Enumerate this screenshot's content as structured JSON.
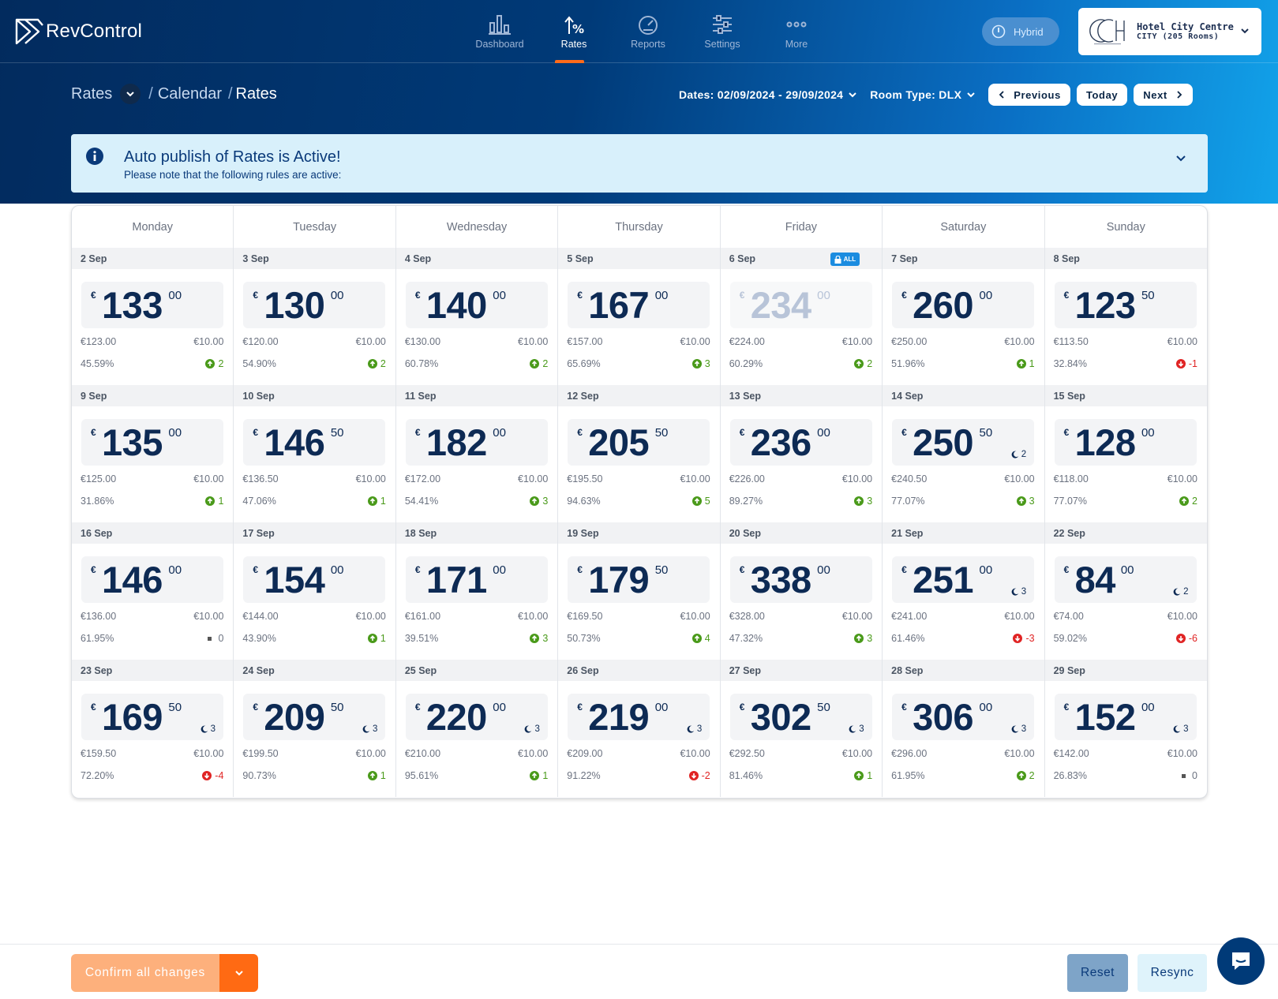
{
  "app": {
    "name": "RevControl"
  },
  "nav": [
    {
      "label": "Dashboard",
      "icon": "bar-chart-icon",
      "active": false
    },
    {
      "label": "Rates",
      "icon": "percent-arrow-icon",
      "active": true
    },
    {
      "label": "Reports",
      "icon": "gauge-icon",
      "active": false
    },
    {
      "label": "Settings",
      "icon": "sliders-icon",
      "active": false
    },
    {
      "label": "More",
      "icon": "more-dots-icon",
      "active": false
    }
  ],
  "mode_badge": "Hybrid",
  "hotel": {
    "name": "Hotel City Centre",
    "subtitle": "CITY (205 Rooms)"
  },
  "breadcrumb": {
    "root": "Rates",
    "middle": "Calendar",
    "current": "Rates",
    "separator": "/"
  },
  "filters": {
    "dates": "Dates: 02/09/2024 - 29/09/2024",
    "room_type": "Room Type: DLX"
  },
  "pager": {
    "previous": "Previous",
    "today": "Today",
    "next": "Next"
  },
  "alert": {
    "title": "Auto publish of Rates is Active!",
    "message": "Please note that the following rules are active:"
  },
  "weekdays": [
    "Monday",
    "Tuesday",
    "Wednesday",
    "Thursday",
    "Friday",
    "Saturday",
    "Sunday"
  ],
  "currency_symbol": "€",
  "lock_label": "ALL",
  "days": [
    {
      "date": "2 Sep",
      "int": "133",
      "dec": "00",
      "base": "€123.00",
      "delta": "€10.00",
      "occupancy": "45.59%",
      "trend": "up",
      "pickup": "2"
    },
    {
      "date": "3 Sep",
      "int": "130",
      "dec": "00",
      "base": "€120.00",
      "delta": "€10.00",
      "occupancy": "54.90%",
      "trend": "up",
      "pickup": "2"
    },
    {
      "date": "4 Sep",
      "int": "140",
      "dec": "00",
      "base": "€130.00",
      "delta": "€10.00",
      "occupancy": "60.78%",
      "trend": "up",
      "pickup": "2"
    },
    {
      "date": "5 Sep",
      "int": "167",
      "dec": "00",
      "base": "€157.00",
      "delta": "€10.00",
      "occupancy": "65.69%",
      "trend": "up",
      "pickup": "3"
    },
    {
      "date": "6 Sep",
      "int": "234",
      "dec": "00",
      "base": "€224.00",
      "delta": "€10.00",
      "occupancy": "60.29%",
      "trend": "up",
      "pickup": "2",
      "locked": true,
      "dimmed": true
    },
    {
      "date": "7 Sep",
      "int": "260",
      "dec": "00",
      "base": "€250.00",
      "delta": "€10.00",
      "occupancy": "51.96%",
      "trend": "up",
      "pickup": "1"
    },
    {
      "date": "8 Sep",
      "int": "123",
      "dec": "50",
      "base": "€113.50",
      "delta": "€10.00",
      "occupancy": "32.84%",
      "trend": "down",
      "pickup": "-1"
    },
    {
      "date": "9 Sep",
      "int": "135",
      "dec": "00",
      "base": "€125.00",
      "delta": "€10.00",
      "occupancy": "31.86%",
      "trend": "up",
      "pickup": "1"
    },
    {
      "date": "10 Sep",
      "int": "146",
      "dec": "50",
      "base": "€136.50",
      "delta": "€10.00",
      "occupancy": "47.06%",
      "trend": "up",
      "pickup": "1"
    },
    {
      "date": "11 Sep",
      "int": "182",
      "dec": "00",
      "base": "€172.00",
      "delta": "€10.00",
      "occupancy": "54.41%",
      "trend": "up",
      "pickup": "3"
    },
    {
      "date": "12 Sep",
      "int": "205",
      "dec": "50",
      "base": "€195.50",
      "delta": "€10.00",
      "occupancy": "94.63%",
      "trend": "up",
      "pickup": "5"
    },
    {
      "date": "13 Sep",
      "int": "236",
      "dec": "00",
      "base": "€226.00",
      "delta": "€10.00",
      "occupancy": "89.27%",
      "trend": "up",
      "pickup": "3"
    },
    {
      "date": "14 Sep",
      "int": "250",
      "dec": "50",
      "base": "€240.50",
      "delta": "€10.00",
      "occupancy": "77.07%",
      "trend": "up",
      "pickup": "3",
      "nights": "2"
    },
    {
      "date": "15 Sep",
      "int": "128",
      "dec": "00",
      "base": "€118.00",
      "delta": "€10.00",
      "occupancy": "77.07%",
      "trend": "up",
      "pickup": "2"
    },
    {
      "date": "16 Sep",
      "int": "146",
      "dec": "00",
      "base": "€136.00",
      "delta": "€10.00",
      "occupancy": "61.95%",
      "trend": "flat",
      "pickup": "0"
    },
    {
      "date": "17 Sep",
      "int": "154",
      "dec": "00",
      "base": "€144.00",
      "delta": "€10.00",
      "occupancy": "43.90%",
      "trend": "up",
      "pickup": "1"
    },
    {
      "date": "18 Sep",
      "int": "171",
      "dec": "00",
      "base": "€161.00",
      "delta": "€10.00",
      "occupancy": "39.51%",
      "trend": "up",
      "pickup": "3"
    },
    {
      "date": "19 Sep",
      "int": "179",
      "dec": "50",
      "base": "€169.50",
      "delta": "€10.00",
      "occupancy": "50.73%",
      "trend": "up",
      "pickup": "4"
    },
    {
      "date": "20 Sep",
      "int": "338",
      "dec": "00",
      "base": "€328.00",
      "delta": "€10.00",
      "occupancy": "47.32%",
      "trend": "up",
      "pickup": "3"
    },
    {
      "date": "21 Sep",
      "int": "251",
      "dec": "00",
      "base": "€241.00",
      "delta": "€10.00",
      "occupancy": "61.46%",
      "trend": "down",
      "pickup": "-3",
      "nights": "3"
    },
    {
      "date": "22 Sep",
      "int": "84",
      "dec": "00",
      "base": "€74.00",
      "delta": "€10.00",
      "occupancy": "59.02%",
      "trend": "down",
      "pickup": "-6",
      "nights": "2"
    },
    {
      "date": "23 Sep",
      "int": "169",
      "dec": "50",
      "base": "€159.50",
      "delta": "€10.00",
      "occupancy": "72.20%",
      "trend": "down",
      "pickup": "-4",
      "nights": "3"
    },
    {
      "date": "24 Sep",
      "int": "209",
      "dec": "50",
      "base": "€199.50",
      "delta": "€10.00",
      "occupancy": "90.73%",
      "trend": "up",
      "pickup": "1",
      "nights": "3"
    },
    {
      "date": "25 Sep",
      "int": "220",
      "dec": "00",
      "base": "€210.00",
      "delta": "€10.00",
      "occupancy": "95.61%",
      "trend": "up",
      "pickup": "1",
      "nights": "3"
    },
    {
      "date": "26 Sep",
      "int": "219",
      "dec": "00",
      "base": "€209.00",
      "delta": "€10.00",
      "occupancy": "91.22%",
      "trend": "down",
      "pickup": "-2",
      "nights": "3"
    },
    {
      "date": "27 Sep",
      "int": "302",
      "dec": "50",
      "base": "€292.50",
      "delta": "€10.00",
      "occupancy": "81.46%",
      "trend": "up",
      "pickup": "1",
      "nights": "3"
    },
    {
      "date": "28 Sep",
      "int": "306",
      "dec": "00",
      "base": "€296.00",
      "delta": "€10.00",
      "occupancy": "61.95%",
      "trend": "up",
      "pickup": "2",
      "nights": "3"
    },
    {
      "date": "29 Sep",
      "int": "152",
      "dec": "00",
      "base": "€142.00",
      "delta": "€10.00",
      "occupancy": "26.83%",
      "trend": "flat",
      "pickup": "0",
      "nights": "3"
    }
  ],
  "footer": {
    "confirm": "Confirm all changes",
    "reset": "Reset",
    "resync": "Resync"
  },
  "colors": {
    "accent_orange": "#ff6a13",
    "navy": "#0d2a54",
    "trend_up": "#4a9a1a",
    "trend_down": "#e02424"
  }
}
